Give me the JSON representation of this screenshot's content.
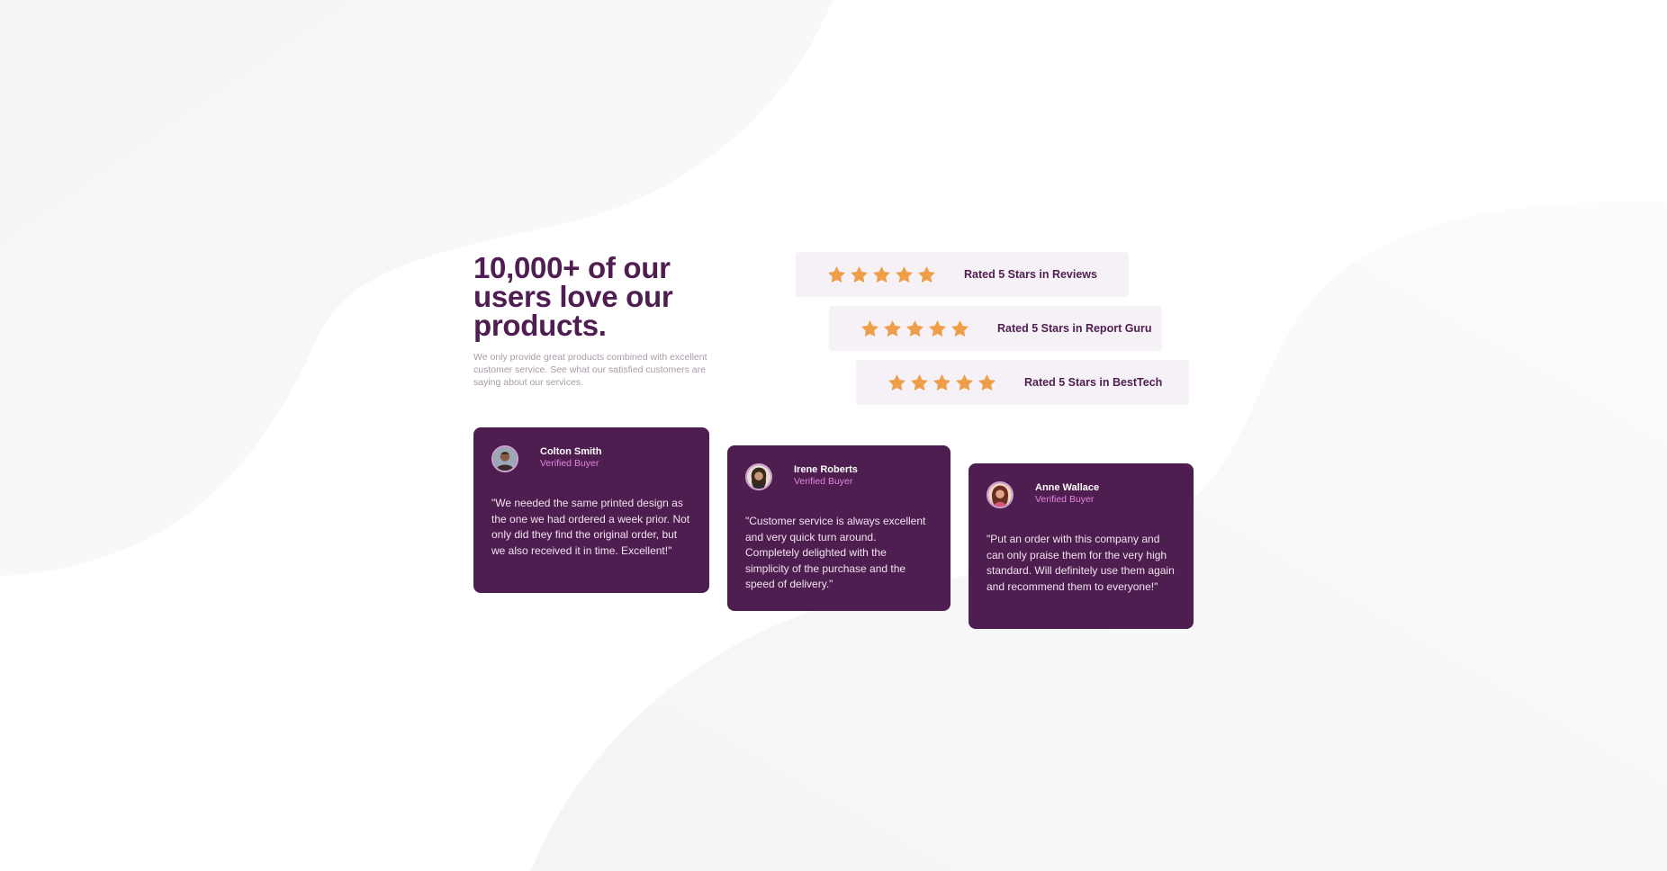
{
  "hero": {
    "title": "10,000+ of our users love our products.",
    "description": "We only provide great products combined with excellent customer service. See what our satisfied customers are saying about our services."
  },
  "ratings": [
    {
      "stars": 5,
      "label": "Rated 5 Stars in Reviews"
    },
    {
      "stars": 5,
      "label": "Rated 5 Stars in Report Guru"
    },
    {
      "stars": 5,
      "label": "Rated 5 Stars in BestTech"
    }
  ],
  "testimonials": [
    {
      "name": "Colton Smith",
      "status": "Verified Buyer",
      "quote": "\"We needed the same printed design as the one we had ordered a week prior. Not only did they find the original order, but we also received it in time. Excellent!\""
    },
    {
      "name": "Irene Roberts",
      "status": "Verified Buyer",
      "quote": "\"Customer service is always excellent and very quick turn around. Completely delighted with the simplicity of the purchase and the speed of delivery.\""
    },
    {
      "name": "Anne Wallace",
      "status": "Verified Buyer",
      "quote": "\"Put an order with this company and can only praise them for the very high standard. Will definitely use them again and recommend them to everyone!\""
    }
  ],
  "colors": {
    "primary": "#4f1d51",
    "star": "#ee9d48",
    "rating_bg": "#f6f1f7",
    "accent": "#e286dd"
  }
}
